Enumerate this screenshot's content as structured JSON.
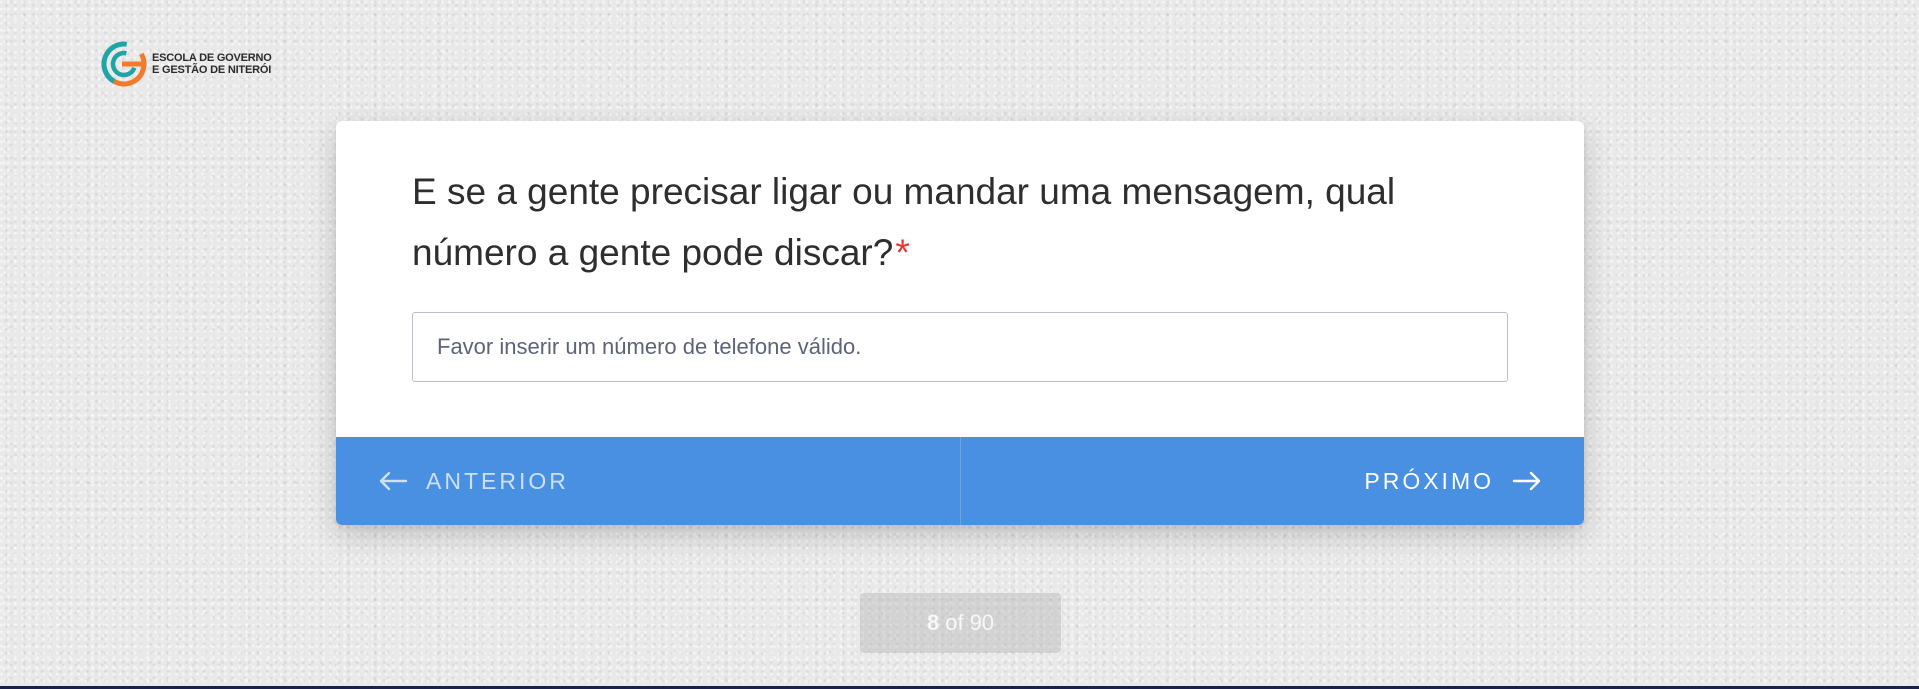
{
  "logo": {
    "line1": "ESCOLA DE GOVERNO",
    "line2": "E GESTÃO DE NITERÓI",
    "icon": "egg-logo-icon",
    "colors": {
      "teal": "#1fa5a8",
      "orange": "#f37a2a"
    }
  },
  "question": {
    "text": "E se a gente precisar ligar ou mandar uma mensagem, qual número a gente pode discar?",
    "required_mark": "*"
  },
  "phone_input": {
    "value": "",
    "placeholder": "Favor inserir um número de telefone válido."
  },
  "navigation": {
    "prev_label": "ANTERIOR",
    "next_label": "PRÓXIMO",
    "prev_icon": "arrow-left-icon",
    "next_icon": "arrow-right-icon",
    "bar_color": "#4a90e2"
  },
  "progress": {
    "current": "8",
    "of_label": "of",
    "total": "90"
  },
  "colors": {
    "required": "#e53935",
    "accent": "#4a90e2"
  }
}
